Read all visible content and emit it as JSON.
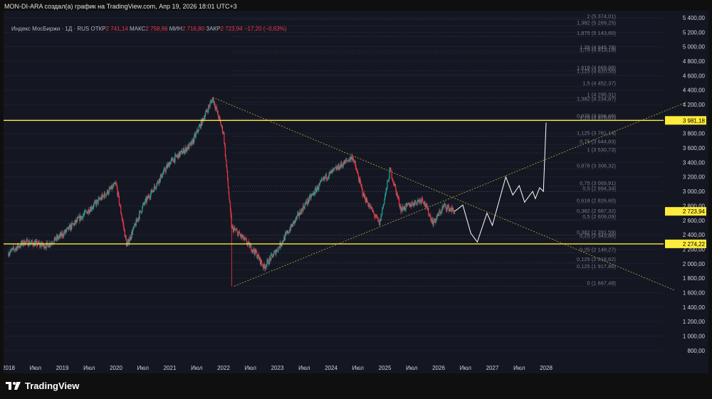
{
  "header": {
    "author_line": "MON-DI-ARA создал(а) график на TradingView.com, Апр 19, 2026 18:01 UTC+3"
  },
  "legend": {
    "symbol": "Индекс МосБиржи · 1Д · RUS",
    "open_label": "ОТКР",
    "open": "2 741,14",
    "high_label": "МАКС",
    "high": "2 758,66",
    "low_label": "МИН",
    "low": "2 716,80",
    "close_label": "ЗАКР",
    "close": "2 723,94",
    "change": "−17,20 (−0,63%)"
  },
  "brand": {
    "name": "TradingView"
  },
  "colors": {
    "up": "#26a69a",
    "down": "#f23645",
    "level": "#ffeb3b",
    "projection": "#ffffff",
    "trend": "#b8a93a"
  },
  "chart_data": {
    "type": "candlestick",
    "title": "Индекс МосБиржи · 1Д · RUS",
    "ylim": [
      700,
      5500
    ],
    "y_ticks": [
      "5 400,00",
      "5 200,00",
      "5 000,00",
      "4 800,00",
      "4 600,00",
      "4 400,00",
      "4 200,00",
      "4 000,00",
      "3 800,00",
      "3 600,00",
      "3 400,00",
      "3 200,00",
      "3 000,00",
      "2 800,00",
      "2 600,00",
      "2 400,00",
      "2 200,00",
      "2 000,00",
      "1 800,00",
      "1 600,00",
      "1 400,00",
      "1 200,00",
      "1 000,00",
      "800,00"
    ],
    "y_tick_values": [
      5400,
      5200,
      5000,
      4800,
      4600,
      4400,
      4200,
      4000,
      3800,
      3600,
      3400,
      3200,
      3000,
      2800,
      2600,
      2400,
      2200,
      2000,
      1800,
      1600,
      1400,
      1200,
      1000,
      800
    ],
    "x_ticks": [
      {
        "label": "2018",
        "t": 2018
      },
      {
        "label": "Июл",
        "t": 2018.5
      },
      {
        "label": "2019",
        "t": 2019
      },
      {
        "label": "Июл",
        "t": 2019.5
      },
      {
        "label": "2020",
        "t": 2020
      },
      {
        "label": "Июл",
        "t": 2020.5
      },
      {
        "label": "2021",
        "t": 2021
      },
      {
        "label": "Июл",
        "t": 2021.5
      },
      {
        "label": "2022",
        "t": 2022
      },
      {
        "label": "Июл",
        "t": 2022.5
      },
      {
        "label": "2023",
        "t": 2023
      },
      {
        "label": "Июл",
        "t": 2023.5
      },
      {
        "label": "2024",
        "t": 2024
      },
      {
        "label": "Июл",
        "t": 2024.5
      },
      {
        "label": "2025",
        "t": 2025
      },
      {
        "label": "Июл",
        "t": 2025.5
      },
      {
        "label": "2026",
        "t": 2026
      },
      {
        "label": "Июл",
        "t": 2026.5
      },
      {
        "label": "2027",
        "t": 2027
      },
      {
        "label": "Июл",
        "t": 2027.5
      },
      {
        "label": "2028",
        "t": 2028
      }
    ],
    "price_path": [
      [
        2018,
        2150
      ],
      [
        2018.3,
        2300
      ],
      [
        2018.7,
        2250
      ],
      [
        2019,
        2400
      ],
      [
        2019.5,
        2750
      ],
      [
        2020,
        3100
      ],
      [
        2020.2,
        2250
      ],
      [
        2020.5,
        2800
      ],
      [
        2021,
        3400
      ],
      [
        2021.4,
        3650
      ],
      [
        2021.8,
        4290
      ],
      [
        2022,
        3800
      ],
      [
        2022.15,
        2500
      ],
      [
        2022.3,
        2400
      ],
      [
        2022.6,
        2150
      ],
      [
        2022.75,
        1950
      ],
      [
        2023,
        2200
      ],
      [
        2023.5,
        2800
      ],
      [
        2023.9,
        3200
      ],
      [
        2024.4,
        3480
      ],
      [
        2024.6,
        2950
      ],
      [
        2024.9,
        2550
      ],
      [
        2025.1,
        3300
      ],
      [
        2025.3,
        2750
      ],
      [
        2025.7,
        2900
      ],
      [
        2025.9,
        2560
      ],
      [
        2026.1,
        2800
      ],
      [
        2026.3,
        2724
      ]
    ],
    "projection": [
      [
        2026.3,
        2724
      ],
      [
        2026.45,
        2810
      ],
      [
        2026.6,
        2420
      ],
      [
        2026.72,
        2300
      ],
      [
        2026.9,
        2700
      ],
      [
        2027.0,
        2530
      ],
      [
        2027.25,
        3200
      ],
      [
        2027.38,
        2950
      ],
      [
        2027.5,
        3080
      ],
      [
        2027.6,
        2850
      ],
      [
        2027.75,
        3000
      ],
      [
        2027.8,
        2900
      ],
      [
        2027.88,
        3050
      ],
      [
        2027.95,
        3000
      ],
      [
        2028.0,
        3950
      ]
    ],
    "levels": [
      {
        "value": 3981.18,
        "label": "3 981,18"
      },
      {
        "value": 2274.22,
        "label": "2 274,22"
      }
    ],
    "last_price": {
      "value": 2723.94,
      "label": "2 723,94"
    },
    "trendlines": [
      {
        "from": [
          2021.8,
          4300
        ],
        "to": [
          2030.4,
          1630
        ]
      },
      {
        "from": [
          2022.2,
          1690
        ],
        "to": [
          2030.6,
          4230
        ]
      }
    ],
    "fib_levels": [
      {
        "label": "2 (5 374,01)",
        "v": 5374.01
      },
      {
        "label": "1,382 (5 289,25)",
        "v": 5289.25
      },
      {
        "label": "1,875 (5 143,60)",
        "v": 5143.6
      },
      {
        "label": "1,25 (4 945,78)",
        "v": 4945.78
      },
      {
        "label": "1,75 (4 913,19)",
        "v": 4913.19
      },
      {
        "label": "1,618 (4 669,88)",
        "v": 4669.88
      },
      {
        "label": "1,125 (4 620,55)",
        "v": 4620.55
      },
      {
        "label": "1,5 (4 452,37)",
        "v": 4452.37
      },
      {
        "label": "1 (4 295,31)",
        "v": 4295.31
      },
      {
        "label": "1,382 (4 234,87)",
        "v": 4234.87
      },
      {
        "label": "0,875 (3 996,65)",
        "v": 3996.65
      },
      {
        "label": "1,25 (3 976,07)",
        "v": 3976.07
      },
      {
        "label": "1,125 (3 761,14)",
        "v": 3761.14
      },
      {
        "label": "0,75 (3 644,83)",
        "v": 3644.83
      },
      {
        "label": "1 (3 530,73)",
        "v": 3530.73
      },
      {
        "label": "0,878 (3 308,32)",
        "v": 3308.32
      },
      {
        "label": "0,75 (3 069,91)",
        "v": 3069.91
      },
      {
        "label": "0,5 (2 994,34)",
        "v": 2994.34
      },
      {
        "label": "0,618 (2 826,60)",
        "v": 2826.6
      },
      {
        "label": "0,382 (2 687,32)",
        "v": 2687.32
      },
      {
        "label": "0,5 (2 609,09)",
        "v": 2609.09
      },
      {
        "label": "0,382 (2 391,59)",
        "v": 2391.59
      },
      {
        "label": "0,25 (2 343,86)",
        "v": 2343.86
      },
      {
        "label": "0,25 (2 148,27)",
        "v": 2148.27
      },
      {
        "label": "0,125 (2 018,62)",
        "v": 2018.62
      },
      {
        "label": "0,125 (1 917,86)",
        "v": 1917.86
      },
      {
        "label": "0 (1 687,48)",
        "v": 1687.48
      }
    ]
  }
}
